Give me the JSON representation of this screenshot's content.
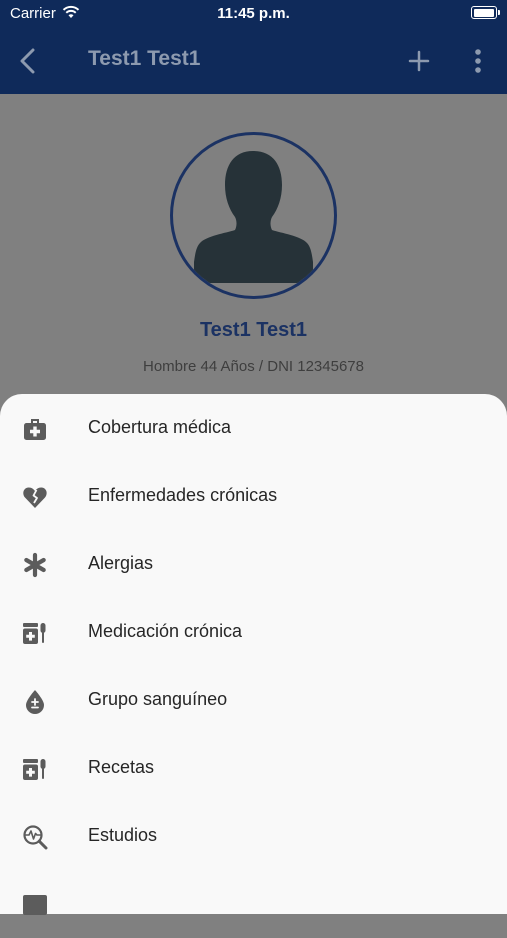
{
  "status_bar": {
    "carrier": "Carrier",
    "time": "11:45 p.m."
  },
  "nav": {
    "title": "Test1 Test1"
  },
  "profile": {
    "name": "Test1 Test1",
    "subtitle": "Hombre 44 Años / DNI 12345678"
  },
  "menu": {
    "items": [
      {
        "label": "Cobertura médica",
        "icon": "medical-kit-icon"
      },
      {
        "label": "Enfermedades crónicas",
        "icon": "broken-heart-icon"
      },
      {
        "label": "Alergias",
        "icon": "asterisk-icon"
      },
      {
        "label": "Medicación crónica",
        "icon": "medication-icon"
      },
      {
        "label": "Grupo sanguíneo",
        "icon": "blood-drop-icon"
      },
      {
        "label": "Recetas",
        "icon": "prescription-icon"
      },
      {
        "label": "Estudios",
        "icon": "lab-study-icon"
      }
    ]
  },
  "colors": {
    "nav_background": "#0f2a5a",
    "accent": "#1b3263",
    "icon": "#5c5c5c",
    "sheet": "#f9f9f9",
    "overlay": "#808080"
  }
}
